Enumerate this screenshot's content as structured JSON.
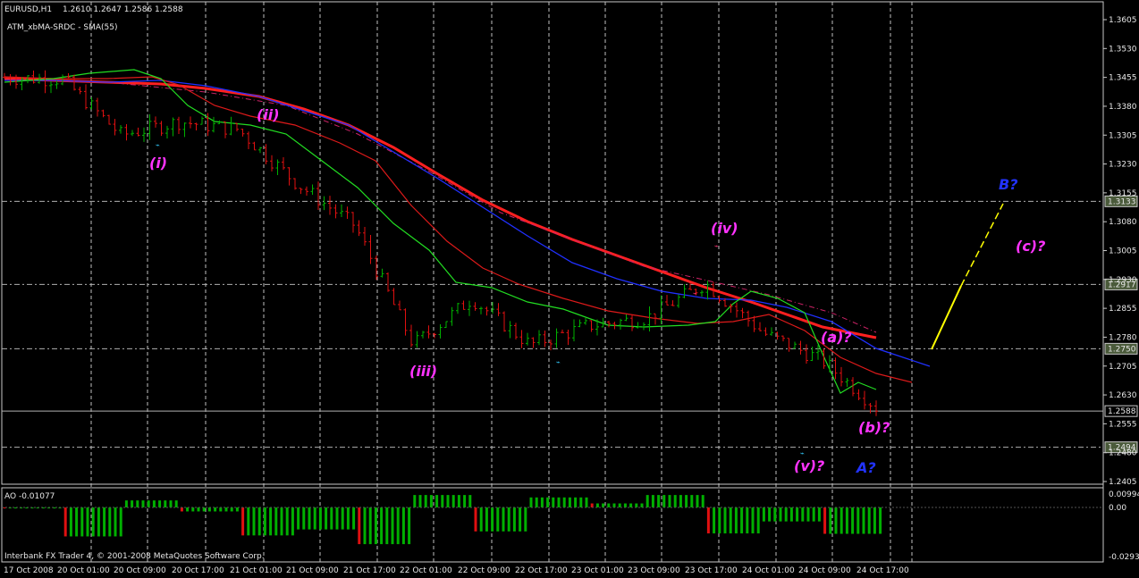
{
  "chart": {
    "symbol_label": "EURUSD,H1",
    "ohlc_label": "1.2610 1.2647 1.2586 1.2588",
    "indicator_label": "ATM_xbMA-SRDC - SMA(55)",
    "ao_label": "AO -0.01077",
    "copyright": "Interbank FX Trader 4, © 2001-2008 MetaQuotes Software Corp."
  },
  "price_axis": {
    "ticks": [
      "1.3605",
      "1.3530",
      "1.3455",
      "1.3380",
      "1.3305",
      "1.3230",
      "1.3155",
      "1.3080",
      "1.3005",
      "1.2930",
      "1.2855",
      "1.2780",
      "1.2705",
      "1.2630",
      "1.2555",
      "1.2480",
      "1.2405"
    ],
    "marker_labels": [
      "1.3133",
      "1.2917",
      "1.2750",
      "1.2588",
      "1.2494"
    ]
  },
  "ao_axis": {
    "ticks": [
      "0.00994",
      "0.00",
      "-0.02938"
    ]
  },
  "time_axis": {
    "ticks": [
      "17 Oct 2008",
      "20 Oct 01:00",
      "20 Oct 09:00",
      "20 Oct 17:00",
      "21 Oct 01:00",
      "21 Oct 09:00",
      "21 Oct 17:00",
      "22 Oct 01:00",
      "22 Oct 09:00",
      "22 Oct 17:00",
      "23 Oct 01:00",
      "23 Oct 09:00",
      "23 Oct 17:00",
      "24 Oct 01:00",
      "24 Oct 09:00",
      "24 Oct 17:00"
    ]
  },
  "wave_labels": [
    {
      "text": "(i)",
      "color": "#ff33ff"
    },
    {
      "text": "(ii)",
      "color": "#ff33ff"
    },
    {
      "text": "(iii)",
      "color": "#ff33ff"
    },
    {
      "text": "(iv)",
      "color": "#ff33ff"
    },
    {
      "text": "(v)?",
      "color": "#ff33ff"
    },
    {
      "text": "(a)?",
      "color": "#ff33ff"
    },
    {
      "text": "(b)?",
      "color": "#ff33ff"
    },
    {
      "text": "(c)?",
      "color": "#ff33ff"
    },
    {
      "text": "A?",
      "color": "#2233ff"
    },
    {
      "text": "B?",
      "color": "#2233ff"
    }
  ],
  "colors": {
    "background": "#000000",
    "grid": "#c0c0c0",
    "bull": "#00b000",
    "bear": "#e01010",
    "sma_red": "#ff2020",
    "ma_blue": "#2030ff",
    "ma_green": "#22dd22",
    "projection": "#ffff00"
  },
  "chart_data": {
    "type": "candlestick",
    "symbol": "EURUSD",
    "timeframe": "H1",
    "last_bar": {
      "open": 1.261,
      "high": 1.2647,
      "low": 1.2586,
      "close": 1.2588
    },
    "ylim": [
      1.2405,
      1.3605
    ],
    "approx_close_path": [
      {
        "t": "17 Oct 2008",
        "price": 1.3455
      },
      {
        "t": "20 Oct 01:00",
        "price": 1.345
      },
      {
        "t": "20 Oct 09:00",
        "price": 1.3305
      },
      {
        "t": "20 Oct 17:00",
        "price": 1.334
      },
      {
        "t": "21 Oct 01:00",
        "price": 1.332
      },
      {
        "t": "21 Oct 09:00",
        "price": 1.318
      },
      {
        "t": "21 Oct 17:00",
        "price": 1.307
      },
      {
        "t": "22 Oct 01:00",
        "price": 1.276
      },
      {
        "t": "22 Oct 09:00",
        "price": 1.288
      },
      {
        "t": "22 Oct 17:00",
        "price": 1.276
      },
      {
        "t": "23 Oct 01:00",
        "price": 1.281
      },
      {
        "t": "23 Oct 09:00",
        "price": 1.283
      },
      {
        "t": "23 Oct 17:00",
        "price": 1.292
      },
      {
        "t": "24 Oct 01:00",
        "price": 1.279
      },
      {
        "t": "24 Oct 09:00",
        "price": 1.272
      },
      {
        "t": "24 Oct 17:00",
        "price": 1.2588
      }
    ],
    "horizontal_levels": [
      1.3133,
      1.2917,
      1.275,
      1.2588,
      1.2494
    ],
    "ao_ylim": [
      -0.02938,
      0.00994
    ]
  }
}
